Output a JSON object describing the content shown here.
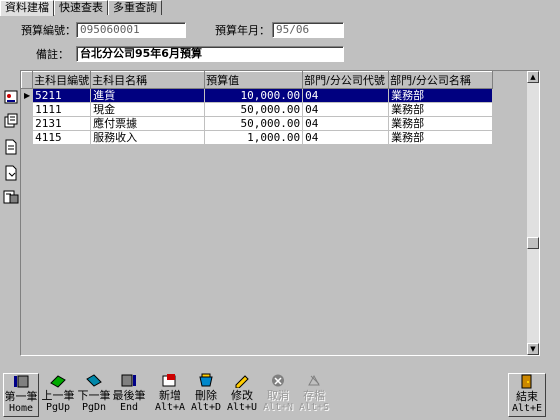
{
  "tabs": [
    "資料建檔",
    "快速查表",
    "多重查詢"
  ],
  "form": {
    "budget_no_label": "預算編號：",
    "budget_no_value": "095060001",
    "budget_ym_label": "預算年月：",
    "budget_ym_value": "95/06",
    "note_label": "備註：",
    "note_value": "台北分公司95年6月預算"
  },
  "grid": {
    "headers": [
      "主科目編號",
      "主科目名稱",
      "預算值",
      "部門/分公司代號",
      "部門/分公司名稱"
    ],
    "rows": [
      [
        "5211",
        "進貨",
        "10,000.00",
        "04",
        "業務部"
      ],
      [
        "1111",
        "現金",
        "50,000.00",
        "04",
        "業務部"
      ],
      [
        "2131",
        "應付票據",
        "50,000.00",
        "04",
        "業務部"
      ],
      [
        "4115",
        "服務收入",
        "1,000.00",
        "04",
        "業務部"
      ]
    ]
  },
  "side_tools": [
    "config-icon",
    "copy-icon",
    "file-icon",
    "export-icon",
    "chart-icon"
  ],
  "buttons": [
    {
      "label": "第一筆",
      "key": "Home",
      "icon": "first-icon"
    },
    {
      "label": "上一筆",
      "key": "PgUp",
      "icon": "prev-icon"
    },
    {
      "label": "下一筆",
      "key": "PgDn",
      "icon": "next-icon"
    },
    {
      "label": "最後筆",
      "key": "End",
      "icon": "last-icon"
    },
    {
      "label": "新增",
      "key": "Alt+A",
      "icon": "add-icon"
    },
    {
      "label": "刪除",
      "key": "Alt+D",
      "icon": "delete-icon"
    },
    {
      "label": "修改",
      "key": "Alt+U",
      "icon": "edit-icon"
    },
    {
      "label": "取消",
      "key": "Alt+N",
      "icon": "cancel-icon"
    },
    {
      "label": "存檔",
      "key": "Alt+S",
      "icon": "save-icon"
    },
    {
      "label": "結束",
      "key": "Alt+E",
      "icon": "exit-icon"
    }
  ],
  "colors": {
    "selected_row": "#000080",
    "background": "#c0c0c0"
  }
}
